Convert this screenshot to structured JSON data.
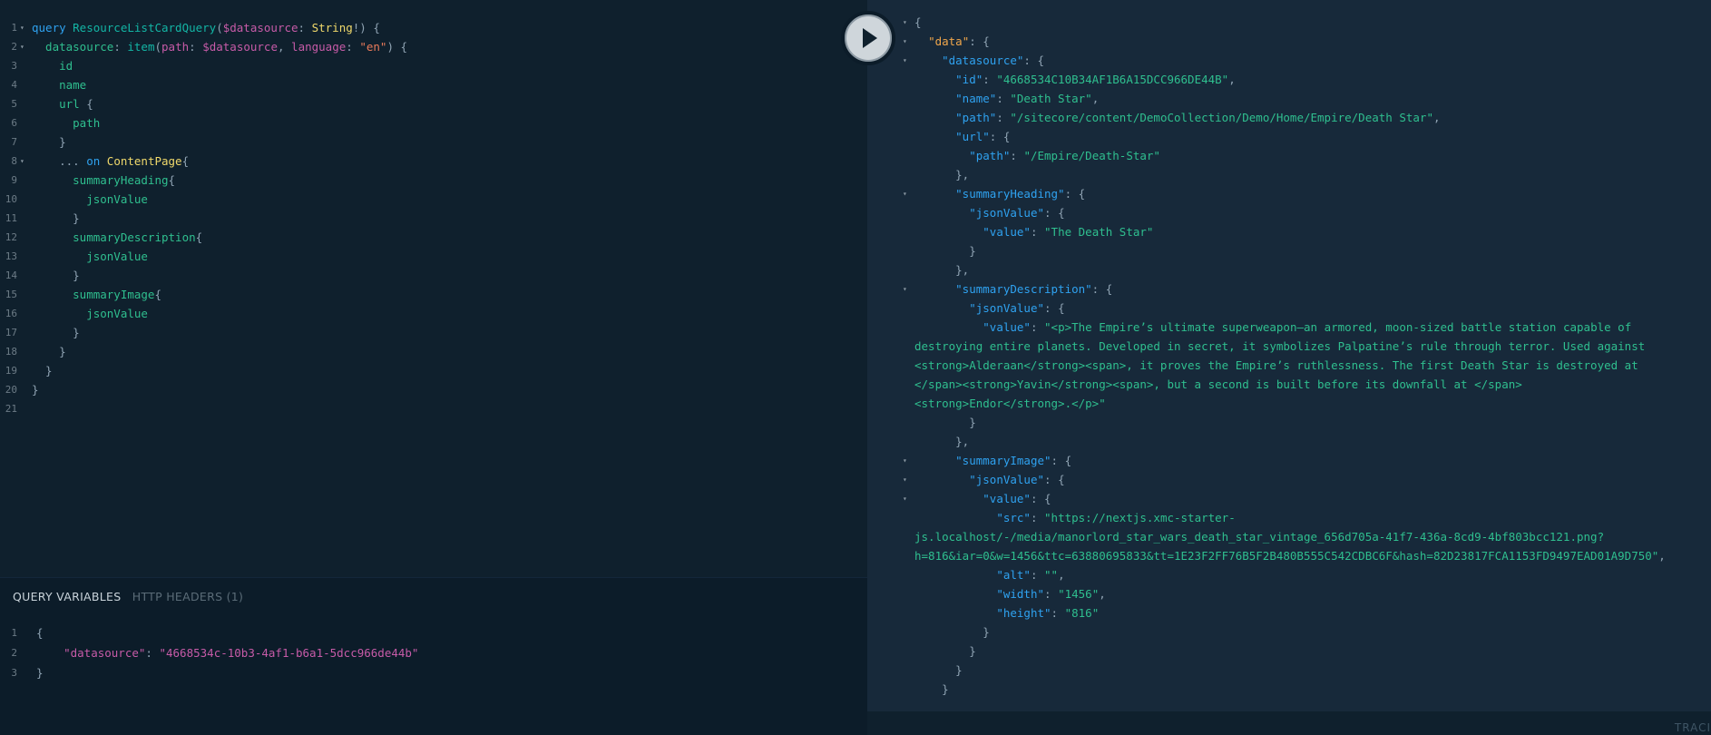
{
  "query_lines": [
    {
      "n": "1",
      "fold": "▾",
      "tokens": [
        {
          "t": "query ",
          "c": "kw"
        },
        {
          "t": "ResourceListCardQuery",
          "c": "def"
        },
        {
          "t": "(",
          "c": "punc"
        },
        {
          "t": "$datasource",
          "c": "var"
        },
        {
          "t": ": ",
          "c": "punc"
        },
        {
          "t": "String",
          "c": "type"
        },
        {
          "t": "!) {",
          "c": "punc"
        }
      ]
    },
    {
      "n": "2",
      "fold": "▾",
      "tokens": [
        {
          "t": "  datasource",
          "c": "fld"
        },
        {
          "t": ": ",
          "c": "punc"
        },
        {
          "t": "item",
          "c": "def"
        },
        {
          "t": "(",
          "c": "punc"
        },
        {
          "t": "path",
          "c": "var"
        },
        {
          "t": ": ",
          "c": "punc"
        },
        {
          "t": "$datasource",
          "c": "var"
        },
        {
          "t": ", ",
          "c": "punc"
        },
        {
          "t": "language",
          "c": "var"
        },
        {
          "t": ": ",
          "c": "punc"
        },
        {
          "t": "\"en\"",
          "c": "str"
        },
        {
          "t": ") {",
          "c": "punc"
        }
      ]
    },
    {
      "n": "3",
      "fold": "",
      "tokens": [
        {
          "t": "    id",
          "c": "fld"
        }
      ]
    },
    {
      "n": "4",
      "fold": "",
      "tokens": [
        {
          "t": "    name",
          "c": "fld"
        }
      ]
    },
    {
      "n": "5",
      "fold": "",
      "tokens": [
        {
          "t": "    url",
          "c": "fld"
        },
        {
          "t": " {",
          "c": "punc"
        }
      ]
    },
    {
      "n": "6",
      "fold": "",
      "tokens": [
        {
          "t": "      path",
          "c": "fld"
        }
      ]
    },
    {
      "n": "7",
      "fold": "",
      "tokens": [
        {
          "t": "    }",
          "c": "punc"
        }
      ]
    },
    {
      "n": "8",
      "fold": "▾",
      "tokens": [
        {
          "t": "    ... ",
          "c": "punc"
        },
        {
          "t": "on ",
          "c": "kw"
        },
        {
          "t": "ContentPage",
          "c": "type"
        },
        {
          "t": "{",
          "c": "punc"
        }
      ]
    },
    {
      "n": "9",
      "fold": "",
      "tokens": [
        {
          "t": "      summaryHeading",
          "c": "fld"
        },
        {
          "t": "{",
          "c": "punc"
        }
      ]
    },
    {
      "n": "10",
      "fold": "",
      "tokens": [
        {
          "t": "        jsonValue",
          "c": "fld"
        }
      ]
    },
    {
      "n": "11",
      "fold": "",
      "tokens": [
        {
          "t": "      }",
          "c": "punc"
        }
      ]
    },
    {
      "n": "12",
      "fold": "",
      "tokens": [
        {
          "t": "      summaryDescription",
          "c": "fld"
        },
        {
          "t": "{",
          "c": "punc"
        }
      ]
    },
    {
      "n": "13",
      "fold": "",
      "tokens": [
        {
          "t": "        jsonValue",
          "c": "fld"
        }
      ]
    },
    {
      "n": "14",
      "fold": "",
      "tokens": [
        {
          "t": "      }",
          "c": "punc"
        }
      ]
    },
    {
      "n": "15",
      "fold": "",
      "tokens": [
        {
          "t": "      summaryImage",
          "c": "fld"
        },
        {
          "t": "{",
          "c": "punc"
        }
      ]
    },
    {
      "n": "16",
      "fold": "",
      "tokens": [
        {
          "t": "        jsonValue",
          "c": "fld"
        }
      ]
    },
    {
      "n": "17",
      "fold": "",
      "tokens": [
        {
          "t": "      }",
          "c": "punc"
        }
      ]
    },
    {
      "n": "18",
      "fold": "",
      "tokens": [
        {
          "t": "    }",
          "c": "punc"
        }
      ]
    },
    {
      "n": "19",
      "fold": "",
      "tokens": [
        {
          "t": "  }",
          "c": "punc"
        }
      ]
    },
    {
      "n": "20",
      "fold": "",
      "tokens": [
        {
          "t": "}",
          "c": "punc"
        }
      ]
    },
    {
      "n": "21",
      "fold": "",
      "tokens": []
    }
  ],
  "vars_panel": {
    "tab_query_variables": "QUERY VARIABLES",
    "tab_http_headers": "HTTP HEADERS (1)",
    "lines": [
      {
        "n": "1",
        "tokens": [
          {
            "t": "{",
            "c": "punc"
          }
        ]
      },
      {
        "n": "2",
        "tokens": [
          {
            "t": "    \"datasource\"",
            "c": "var"
          },
          {
            "t": ": ",
            "c": "punc"
          },
          {
            "t": "\"4668534c-10b3-4af1-b6a1-5dcc966de44b\"",
            "c": "var"
          }
        ]
      },
      {
        "n": "3",
        "tokens": [
          {
            "t": "}",
            "c": "punc"
          }
        ]
      }
    ]
  },
  "result_lines": [
    {
      "fold": "▾",
      "tokens": [
        {
          "t": "{",
          "c": "rp"
        }
      ]
    },
    {
      "fold": "▾",
      "tokens": [
        {
          "t": "  ",
          "c": "rp"
        },
        {
          "t": "\"data\"",
          "c": "rkey-root"
        },
        {
          "t": ": {",
          "c": "rp"
        }
      ]
    },
    {
      "fold": "▾",
      "tokens": [
        {
          "t": "    ",
          "c": "rp"
        },
        {
          "t": "\"datasource\"",
          "c": "rkey"
        },
        {
          "t": ": {",
          "c": "rp"
        }
      ]
    },
    {
      "fold": "",
      "tokens": [
        {
          "t": "      ",
          "c": "rp"
        },
        {
          "t": "\"id\"",
          "c": "rkey"
        },
        {
          "t": ": ",
          "c": "rp"
        },
        {
          "t": "\"4668534C10B34AF1B6A15DCC966DE44B\"",
          "c": "rstr"
        },
        {
          "t": ",",
          "c": "rp"
        }
      ]
    },
    {
      "fold": "",
      "tokens": [
        {
          "t": "      ",
          "c": "rp"
        },
        {
          "t": "\"name\"",
          "c": "rkey"
        },
        {
          "t": ": ",
          "c": "rp"
        },
        {
          "t": "\"Death Star\"",
          "c": "rstr"
        },
        {
          "t": ",",
          "c": "rp"
        }
      ]
    },
    {
      "fold": "",
      "tokens": [
        {
          "t": "      ",
          "c": "rp"
        },
        {
          "t": "\"path\"",
          "c": "rkey"
        },
        {
          "t": ": ",
          "c": "rp"
        },
        {
          "t": "\"/sitecore/content/DemoCollection/Demo/Home/Empire/Death Star\"",
          "c": "rstr"
        },
        {
          "t": ",",
          "c": "rp"
        }
      ]
    },
    {
      "fold": "",
      "tokens": [
        {
          "t": "      ",
          "c": "rp"
        },
        {
          "t": "\"url\"",
          "c": "rkey"
        },
        {
          "t": ": {",
          "c": "rp"
        }
      ]
    },
    {
      "fold": "",
      "tokens": [
        {
          "t": "        ",
          "c": "rp"
        },
        {
          "t": "\"path\"",
          "c": "rkey"
        },
        {
          "t": ": ",
          "c": "rp"
        },
        {
          "t": "\"/Empire/Death-Star\"",
          "c": "rstr"
        }
      ]
    },
    {
      "fold": "",
      "tokens": [
        {
          "t": "      },",
          "c": "rp"
        }
      ]
    },
    {
      "fold": "▾",
      "tokens": [
        {
          "t": "      ",
          "c": "rp"
        },
        {
          "t": "\"summaryHeading\"",
          "c": "rkey"
        },
        {
          "t": ": {",
          "c": "rp"
        }
      ]
    },
    {
      "fold": "",
      "tokens": [
        {
          "t": "        ",
          "c": "rp"
        },
        {
          "t": "\"jsonValue\"",
          "c": "rkey"
        },
        {
          "t": ": {",
          "c": "rp"
        }
      ]
    },
    {
      "fold": "",
      "tokens": [
        {
          "t": "          ",
          "c": "rp"
        },
        {
          "t": "\"value\"",
          "c": "rkey"
        },
        {
          "t": ": ",
          "c": "rp"
        },
        {
          "t": "\"The Death Star\"",
          "c": "rstr"
        }
      ]
    },
    {
      "fold": "",
      "tokens": [
        {
          "t": "        }",
          "c": "rp"
        }
      ]
    },
    {
      "fold": "",
      "tokens": [
        {
          "t": "      },",
          "c": "rp"
        }
      ]
    },
    {
      "fold": "▾",
      "tokens": [
        {
          "t": "      ",
          "c": "rp"
        },
        {
          "t": "\"summaryDescription\"",
          "c": "rkey"
        },
        {
          "t": ": {",
          "c": "rp"
        }
      ]
    },
    {
      "fold": "",
      "tokens": [
        {
          "t": "        ",
          "c": "rp"
        },
        {
          "t": "\"jsonValue\"",
          "c": "rkey"
        },
        {
          "t": ": {",
          "c": "rp"
        }
      ]
    },
    {
      "fold": "",
      "tokens": [
        {
          "t": "          ",
          "c": "rp"
        },
        {
          "t": "\"value\"",
          "c": "rkey"
        },
        {
          "t": ": ",
          "c": "rp"
        },
        {
          "t": "\"<p>The Empire’s ultimate superweapon—an armored, moon-sized battle station capable of",
          "c": "rstr"
        }
      ]
    },
    {
      "fold": "",
      "tokens": [
        {
          "t": "destroying entire planets. Developed in secret, it symbolizes Palpatine’s rule through terror. Used against",
          "c": "rstr"
        }
      ]
    },
    {
      "fold": "",
      "tokens": [
        {
          "t": "<strong>Alderaan</strong><span>, it proves the Empire’s ruthlessness. The first Death Star is destroyed at",
          "c": "rstr"
        }
      ]
    },
    {
      "fold": "",
      "tokens": [
        {
          "t": "</span><strong>Yavin</strong><span>, but a second is built before its downfall at </span>",
          "c": "rstr"
        }
      ]
    },
    {
      "fold": "",
      "tokens": [
        {
          "t": "<strong>Endor</strong>.</p>\"",
          "c": "rstr"
        }
      ]
    },
    {
      "fold": "",
      "tokens": [
        {
          "t": "        }",
          "c": "rp"
        }
      ]
    },
    {
      "fold": "",
      "tokens": [
        {
          "t": "      },",
          "c": "rp"
        }
      ]
    },
    {
      "fold": "▾",
      "tokens": [
        {
          "t": "      ",
          "c": "rp"
        },
        {
          "t": "\"summaryImage\"",
          "c": "rkey"
        },
        {
          "t": ": {",
          "c": "rp"
        }
      ]
    },
    {
      "fold": "▾",
      "tokens": [
        {
          "t": "        ",
          "c": "rp"
        },
        {
          "t": "\"jsonValue\"",
          "c": "rkey"
        },
        {
          "t": ": {",
          "c": "rp"
        }
      ]
    },
    {
      "fold": "▾",
      "tokens": [
        {
          "t": "          ",
          "c": "rp"
        },
        {
          "t": "\"value\"",
          "c": "rkey"
        },
        {
          "t": ": {",
          "c": "rp"
        }
      ]
    },
    {
      "fold": "",
      "tokens": [
        {
          "t": "            ",
          "c": "rp"
        },
        {
          "t": "\"src\"",
          "c": "rkey"
        },
        {
          "t": ": ",
          "c": "rp"
        },
        {
          "t": "\"https://nextjs.xmc-starter-",
          "c": "rstr"
        }
      ]
    },
    {
      "fold": "",
      "tokens": [
        {
          "t": "js.localhost/-/media/manorlord_star_wars_death_star_vintage_656d705a-41f7-436a-8cd9-4bf803bcc121.png?",
          "c": "rstr"
        }
      ]
    },
    {
      "fold": "",
      "tokens": [
        {
          "t": "h=816&iar=0&w=1456&ttc=63880695833&tt=1E23F2FF76B5F2B480B555C542CDBC6F&hash=82D23817FCA1153FD9497EAD01A9D750\"",
          "c": "rstr"
        },
        {
          "t": ",",
          "c": "rp"
        }
      ]
    },
    {
      "fold": "",
      "tokens": [
        {
          "t": "            ",
          "c": "rp"
        },
        {
          "t": "\"alt\"",
          "c": "rkey"
        },
        {
          "t": ": ",
          "c": "rp"
        },
        {
          "t": "\"\"",
          "c": "rstr"
        },
        {
          "t": ",",
          "c": "rp"
        }
      ]
    },
    {
      "fold": "",
      "tokens": [
        {
          "t": "            ",
          "c": "rp"
        },
        {
          "t": "\"width\"",
          "c": "rkey"
        },
        {
          "t": ": ",
          "c": "rp"
        },
        {
          "t": "\"1456\"",
          "c": "rstr"
        },
        {
          "t": ",",
          "c": "rp"
        }
      ]
    },
    {
      "fold": "",
      "tokens": [
        {
          "t": "            ",
          "c": "rp"
        },
        {
          "t": "\"height\"",
          "c": "rkey"
        },
        {
          "t": ": ",
          "c": "rp"
        },
        {
          "t": "\"816\"",
          "c": "rstr"
        }
      ]
    },
    {
      "fold": "",
      "tokens": [
        {
          "t": "          }",
          "c": "rp"
        }
      ]
    },
    {
      "fold": "",
      "tokens": [
        {
          "t": "        }",
          "c": "rp"
        }
      ]
    },
    {
      "fold": "",
      "tokens": [
        {
          "t": "      }",
          "c": "rp"
        }
      ]
    },
    {
      "fold": "",
      "tokens": [
        {
          "t": "    }",
          "c": "rp"
        }
      ]
    }
  ],
  "run_button": {
    "icon": "play-icon"
  },
  "trace_label": "TRACI",
  "colors": {
    "editor_bg": "#0f202d",
    "result_bg": "#17293a",
    "vars_bg": "#0c1c29",
    "keyword": "#2fa2f0",
    "field": "#2fbf8f",
    "variable": "#c75ba8",
    "type": "#f0d96b",
    "root_key": "#f0a64b"
  }
}
